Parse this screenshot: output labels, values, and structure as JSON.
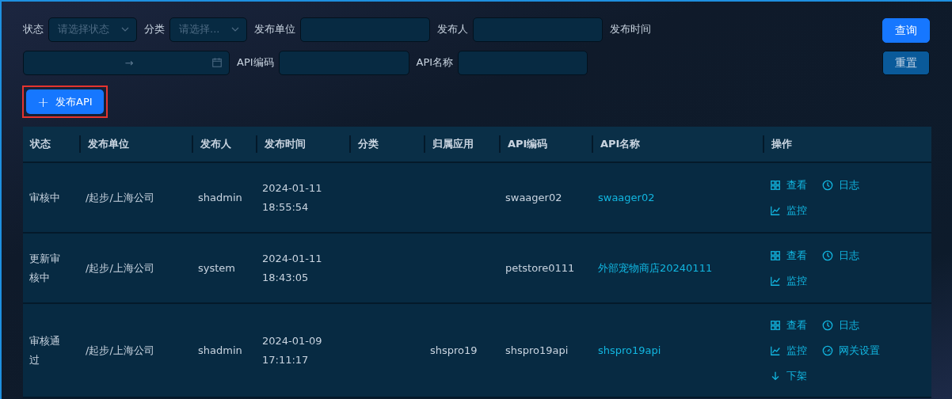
{
  "filters": [
    {
      "kind": "select",
      "label": "状态",
      "placeholder": "请选择状态"
    },
    {
      "kind": "select",
      "label": "分类",
      "placeholder": "请选择..."
    },
    {
      "kind": "input",
      "label": "发布单位"
    },
    {
      "kind": "input",
      "label": "发布人"
    },
    {
      "kind": "label",
      "label": "发布时间"
    },
    {
      "kind": "daterange",
      "separator": "→"
    },
    {
      "kind": "input",
      "label": "API编码"
    },
    {
      "kind": "input",
      "label": "API名称"
    }
  ],
  "query_button": "查询",
  "reset_button": "重置",
  "publish_button": {
    "icon": "+",
    "label": "发布API"
  },
  "table": {
    "columns": [
      "状态",
      "发布单位",
      "发布人",
      "发布时间",
      "分类",
      "归属应用",
      "API编码",
      "API名称",
      "操作"
    ],
    "rows": [
      {
        "status": "审核中",
        "unit": "/起步/上海公司",
        "publisher": "shadmin",
        "time": [
          "2024-01-11",
          "18:55:54"
        ],
        "app": "",
        "code": "swaager02",
        "name": "swaager02",
        "actions": [
          {
            "kind": "view",
            "label": "查看"
          },
          {
            "kind": "log",
            "label": "日志"
          },
          {
            "kind": "monitor",
            "label": "监控"
          }
        ]
      },
      {
        "status": "更新审核中",
        "unit": "/起步/上海公司",
        "publisher": "system",
        "time": [
          "2024-01-11",
          "18:43:05"
        ],
        "app": "",
        "code": "petstore0111",
        "name": "外部宠物商店20240111",
        "actions": [
          {
            "kind": "view",
            "label": "查看"
          },
          {
            "kind": "log",
            "label": "日志"
          },
          {
            "kind": "monitor",
            "label": "监控"
          }
        ]
      },
      {
        "status": "审核通过",
        "unit": "/起步/上海公司",
        "publisher": "shadmin",
        "time": [
          "2024-01-09",
          "17:11:17"
        ],
        "app": "shspro19",
        "code": "shspro19api",
        "name": "shspro19api",
        "actions": [
          {
            "kind": "view",
            "label": "查看"
          },
          {
            "kind": "log",
            "label": "日志"
          },
          {
            "kind": "monitor",
            "label": "监控"
          },
          {
            "kind": "gateway",
            "label": "网关设置"
          },
          {
            "kind": "offline",
            "label": "下架"
          }
        ]
      }
    ]
  }
}
